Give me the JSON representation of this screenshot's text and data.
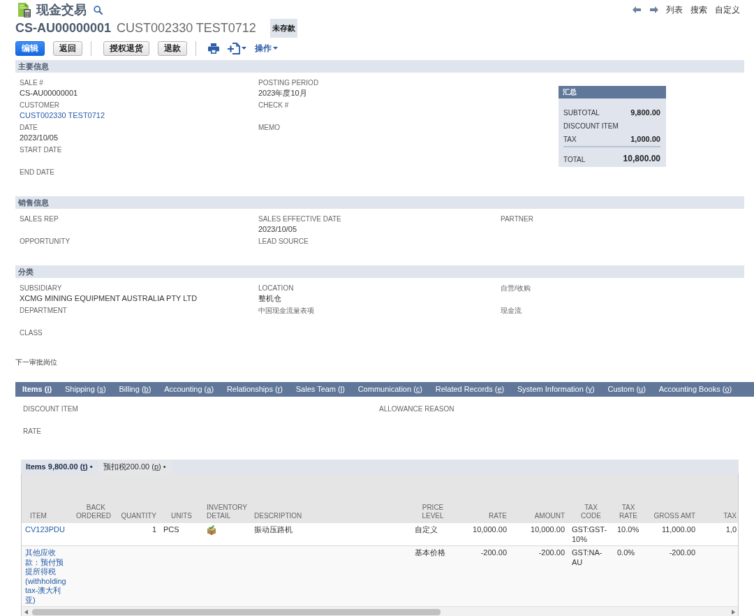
{
  "header": {
    "title": "现金交易",
    "record_number": "CS-AU00000001",
    "customer_name": "CUST002330 TEST0712",
    "status": "未存款",
    "nav_links": [
      "列表",
      "搜索",
      "自定义"
    ]
  },
  "toolbar": {
    "button_groups": [
      [
        {
          "label": "编辑",
          "kind": "primary"
        },
        {
          "label": "返回",
          "kind": "secondary"
        }
      ],
      [
        {
          "label": "授权退货",
          "kind": "secondary"
        },
        {
          "label": "退款",
          "kind": "secondary"
        }
      ]
    ],
    "actions_menu": "操作"
  },
  "sections": [
    {
      "title": "主要信息",
      "columns": [
        [
          {
            "label": "SALE #",
            "value": "CS-AU00000001"
          },
          {
            "label": "CUSTOMER",
            "value": "CUST002330 TEST0712",
            "link": true
          },
          {
            "label": "DATE",
            "value": "2023/10/05"
          },
          {
            "label": "START DATE"
          },
          {
            "label": "END DATE"
          }
        ],
        [
          {
            "label": "POSTING PERIOD",
            "value": "2023年度10月"
          },
          {
            "label": "CHECK #"
          },
          {
            "label": "MEMO"
          }
        ]
      ],
      "summary": {
        "title": "汇总",
        "lines": [
          {
            "label": "SUBTOTAL",
            "value": "9,800.00"
          },
          {
            "label": "DISCOUNT ITEM"
          },
          {
            "label": "TAX",
            "value": "1,000.00"
          }
        ],
        "total": {
          "label": "TOTAL",
          "value": "10,800.00"
        }
      }
    },
    {
      "title": "销售信息",
      "columns": [
        [
          {
            "label": "SALES REP"
          },
          {
            "label": "OPPORTUNITY"
          }
        ],
        [
          {
            "label": "SALES EFFECTIVE DATE",
            "value": "2023/10/05"
          },
          {
            "label": "LEAD SOURCE"
          }
        ],
        [
          {
            "label": "PARTNER"
          }
        ]
      ]
    },
    {
      "title": "分类",
      "columns": [
        [
          {
            "label": "SUBSIDIARY",
            "value": "XCMG MINING EQUIPMENT AUSTRALIA PTY LTD"
          },
          {
            "label": "DEPARTMENT"
          },
          {
            "label": "CLASS"
          }
        ],
        [
          {
            "label": "LOCATION",
            "value": "整机仓"
          },
          {
            "label": "中国现金流量表项"
          }
        ],
        [
          {
            "label": "自营/收购"
          },
          {
            "label": "现金流"
          }
        ]
      ]
    }
  ],
  "approver_label": "下一审批岗位",
  "tabs": [
    {
      "label": "Items (i)",
      "selected": true
    },
    {
      "label": "Shipping (s)",
      "selected": false
    },
    {
      "label": "Billing (b)",
      "selected": false
    },
    {
      "label": "Accounting (a)",
      "selected": false
    },
    {
      "label": "Relationships (r)",
      "selected": false
    },
    {
      "label": "Sales Team (l)",
      "selected": false
    },
    {
      "label": "Communication (c)",
      "selected": false
    },
    {
      "label": "Related Records (e)",
      "selected": false
    },
    {
      "label": "System Information (y)",
      "selected": false
    },
    {
      "label": "Custom (u)",
      "selected": false
    },
    {
      "label": "Accounting Books (o)",
      "selected": false
    }
  ],
  "items_tab_fields": [
    [
      {
        "label": "DISCOUNT ITEM"
      },
      {
        "label": "RATE"
      }
    ],
    [
      {
        "label": "ALLOWANCE REASON"
      }
    ]
  ],
  "subtabs": [
    {
      "label": "Items 9,800.00 (t) •",
      "selected": true
    },
    {
      "label": "预扣税200.00 (p) •",
      "selected": false
    }
  ],
  "table": {
    "columns": [
      "ITEM",
      "BACK ORDERED",
      "QUANTITY",
      "UNITS",
      "INVENTORY DETAIL",
      "DESCRIPTION",
      "PRICE LEVEL",
      "RATE",
      "AMOUNT",
      "TAX CODE",
      "TAX RATE",
      "GROSS AMT",
      "TAX"
    ],
    "rows": [
      {
        "item": "CV123PDU",
        "quantity": "1",
        "units": "PCS",
        "has_inventory_detail": true,
        "description": "振动压路机",
        "price_level": "自定义",
        "rate": "10,000.00",
        "amount": "10,000.00",
        "tax_code": "GST:GST-10%",
        "tax_rate": "10.0%",
        "gross_amt": "11,000.00",
        "column_13": "1,0"
      },
      {
        "item": "其他应收款：预付预提所得税(withholding tax-澳大利亚)",
        "has_inventory_detail": false,
        "price_level": "基本价格",
        "rate": "-200.00",
        "amount": "-200.00",
        "tax_code": "GST:NA-AU",
        "tax_rate": "0.0%",
        "gross_amt": "-200.00"
      }
    ]
  }
}
